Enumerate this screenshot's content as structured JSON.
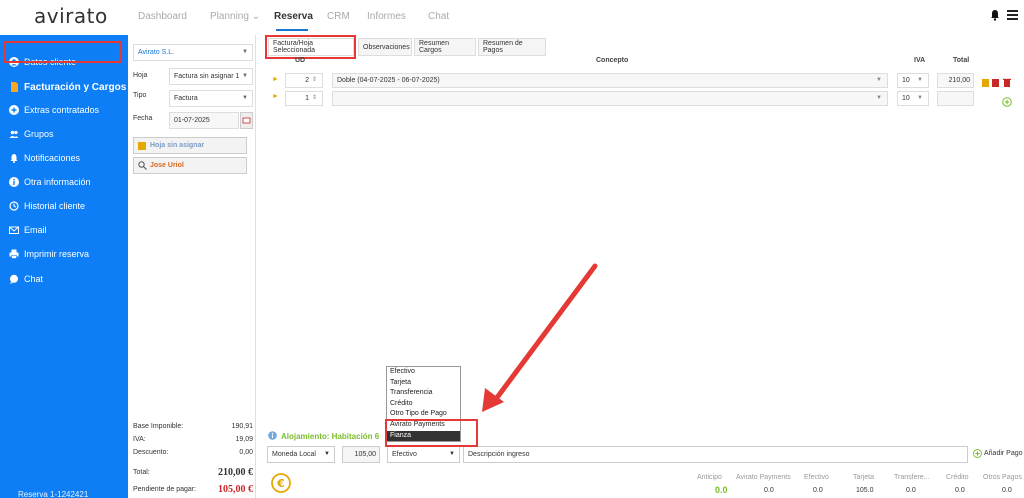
{
  "app": {
    "logo": "avirato"
  },
  "nav": {
    "items": [
      "Dashboard",
      "Planning",
      "Reserva",
      "CRM",
      "Informes",
      "Chat"
    ],
    "planning_caret": "⌄"
  },
  "sidebar": {
    "items": [
      {
        "label": "Datos cliente",
        "icon": "user-circle-icon"
      },
      {
        "label": "Facturación y Cargos",
        "icon": "document-icon"
      },
      {
        "label": "Extras contratados",
        "icon": "plus-circle-icon"
      },
      {
        "label": "Grupos",
        "icon": "group-icon"
      },
      {
        "label": "Notificaciones",
        "icon": "bell-icon"
      },
      {
        "label": "Otra información",
        "icon": "info-icon"
      },
      {
        "label": "Historial cliente",
        "icon": "history-icon"
      },
      {
        "label": "Email",
        "icon": "mail-icon"
      },
      {
        "label": "Imprimir reserva",
        "icon": "printer-icon"
      },
      {
        "label": "Chat",
        "icon": "chat-icon"
      }
    ],
    "footer": "Reserva 1-1242421"
  },
  "leftpanel": {
    "company": "Avirato S.L.",
    "hoja_label": "Hoja",
    "hoja_value": "Factura  sin asignar 1",
    "tipo_label": "Tipo",
    "tipo_value": "Factura",
    "fecha_label": "Fecha",
    "fecha_value": "01-07-2025",
    "hoja_btn": "Hoja sin asignar",
    "person_btn": "Jose Uriol",
    "base_label": "Base Imponible:",
    "base_value": "190,91",
    "iva_label": "IVA:",
    "iva_value": "19,09",
    "desc_label": "Descuento:",
    "desc_value": "0,00",
    "total_label": "Total:",
    "total_value": "210,00 €",
    "pend_label": "Pendiente de pagar:",
    "pend_value": "105,00 €"
  },
  "tabs": [
    "Factura/Hoja Seleccionada",
    "Observaciones",
    "Resumen Cargos",
    "Resumen de Pagos"
  ],
  "table": {
    "headers": {
      "ud": "UD",
      "concepto": "Concepto",
      "iva": "IVA",
      "total": "Total"
    },
    "rows": [
      {
        "ud": "2",
        "concepto": "Doble (04-07-2025 - 06-07-2025)",
        "iva": "10",
        "total": "210,00"
      },
      {
        "ud": "1",
        "concepto": "",
        "iva": "10",
        "total": ""
      }
    ]
  },
  "dropdown": {
    "options": [
      "Efectivo",
      "Tarjeta",
      "Transferencia",
      "Crédito",
      "Otro Tipo de Pago",
      "Avirato Payments",
      "Fianza"
    ],
    "selected": "Fianza"
  },
  "payment": {
    "alojamiento": "Alojamiento: Habitación 6",
    "moneda": "Moneda Local",
    "amount": "105,00",
    "method": "Efectivo",
    "desc_placeholder": "Descripción ingreso",
    "add_btn": "Añadir Pago"
  },
  "summary": {
    "labels": [
      "Anticipo",
      "Avirato Payments",
      "Efectivo",
      "Tarjeta",
      "Transfere...",
      "Crédito",
      "Otros Pagos"
    ],
    "values": [
      "0.0",
      "0.0",
      "0.0",
      "105.0",
      "0.0",
      "0.0",
      "0.0"
    ]
  },
  "colors": {
    "accent": "#0d7ef5",
    "highlight": "#e53935",
    "green": "#7cbd2c",
    "red_total": "#c62828"
  }
}
